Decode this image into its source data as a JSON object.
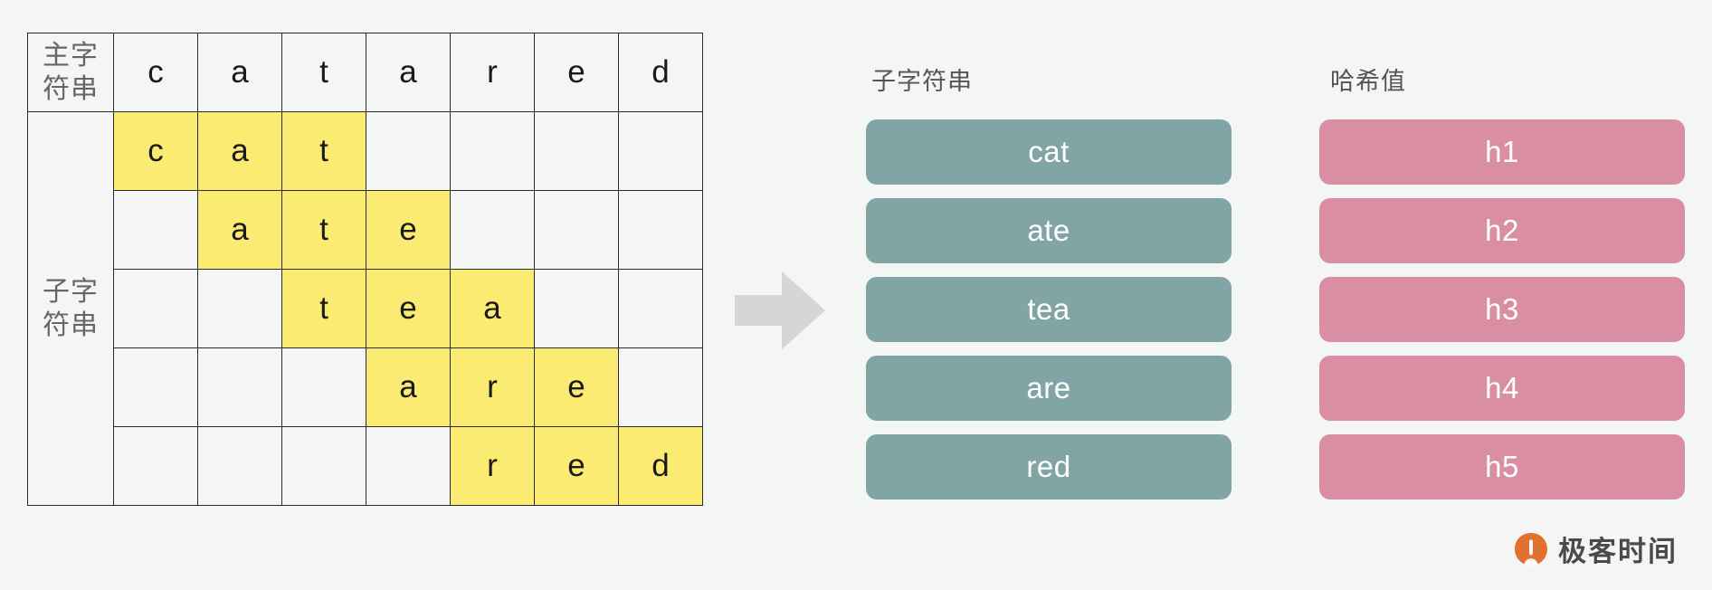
{
  "matrix": {
    "main_string_label_line1": "主字",
    "main_string_label_line2": "符串",
    "sub_string_label_line1": "子字",
    "sub_string_label_line2": "符串",
    "main_string_chars": [
      "c",
      "a",
      "t",
      "a",
      "r",
      "e",
      "d"
    ],
    "rows": [
      {
        "substring": "cat",
        "cells": [
          "c",
          "a",
          "t",
          "",
          "",
          "",
          ""
        ],
        "highlight": [
          true,
          true,
          true,
          false,
          false,
          false,
          false
        ]
      },
      {
        "substring": "ate",
        "cells": [
          "",
          "a",
          "t",
          "e",
          "",
          "",
          ""
        ],
        "highlight": [
          false,
          true,
          true,
          true,
          false,
          false,
          false
        ]
      },
      {
        "substring": "tea",
        "cells": [
          "",
          "",
          "t",
          "e",
          "a",
          "",
          ""
        ],
        "highlight": [
          false,
          false,
          true,
          true,
          true,
          false,
          false
        ]
      },
      {
        "substring": "are",
        "cells": [
          "",
          "",
          "",
          "a",
          "r",
          "e",
          ""
        ],
        "highlight": [
          false,
          false,
          false,
          true,
          true,
          true,
          false
        ]
      },
      {
        "substring": "red",
        "cells": [
          "",
          "",
          "",
          "",
          "r",
          "e",
          "d"
        ],
        "highlight": [
          false,
          false,
          false,
          false,
          true,
          true,
          true
        ]
      }
    ]
  },
  "arrow": {
    "icon": "arrow-right-icon",
    "color": "#d6d6d6"
  },
  "columns": {
    "substrings": {
      "title": "子字符串",
      "color": "#81a5a4",
      "items": [
        "cat",
        "ate",
        "tea",
        "are",
        "red"
      ]
    },
    "hashes": {
      "title": "哈希值",
      "color": "#d98ea4",
      "items": [
        "h1",
        "h2",
        "h3",
        "h4",
        "h5"
      ]
    }
  },
  "logo": {
    "wordmark": "极客时间",
    "icon": "geektime-logo-icon",
    "accent_color": "#e0712f"
  },
  "theme": {
    "background": "#f4f6f6",
    "highlight": "#fbeb72",
    "grid_line": "#2b2b2b",
    "label_text": "#666666"
  }
}
